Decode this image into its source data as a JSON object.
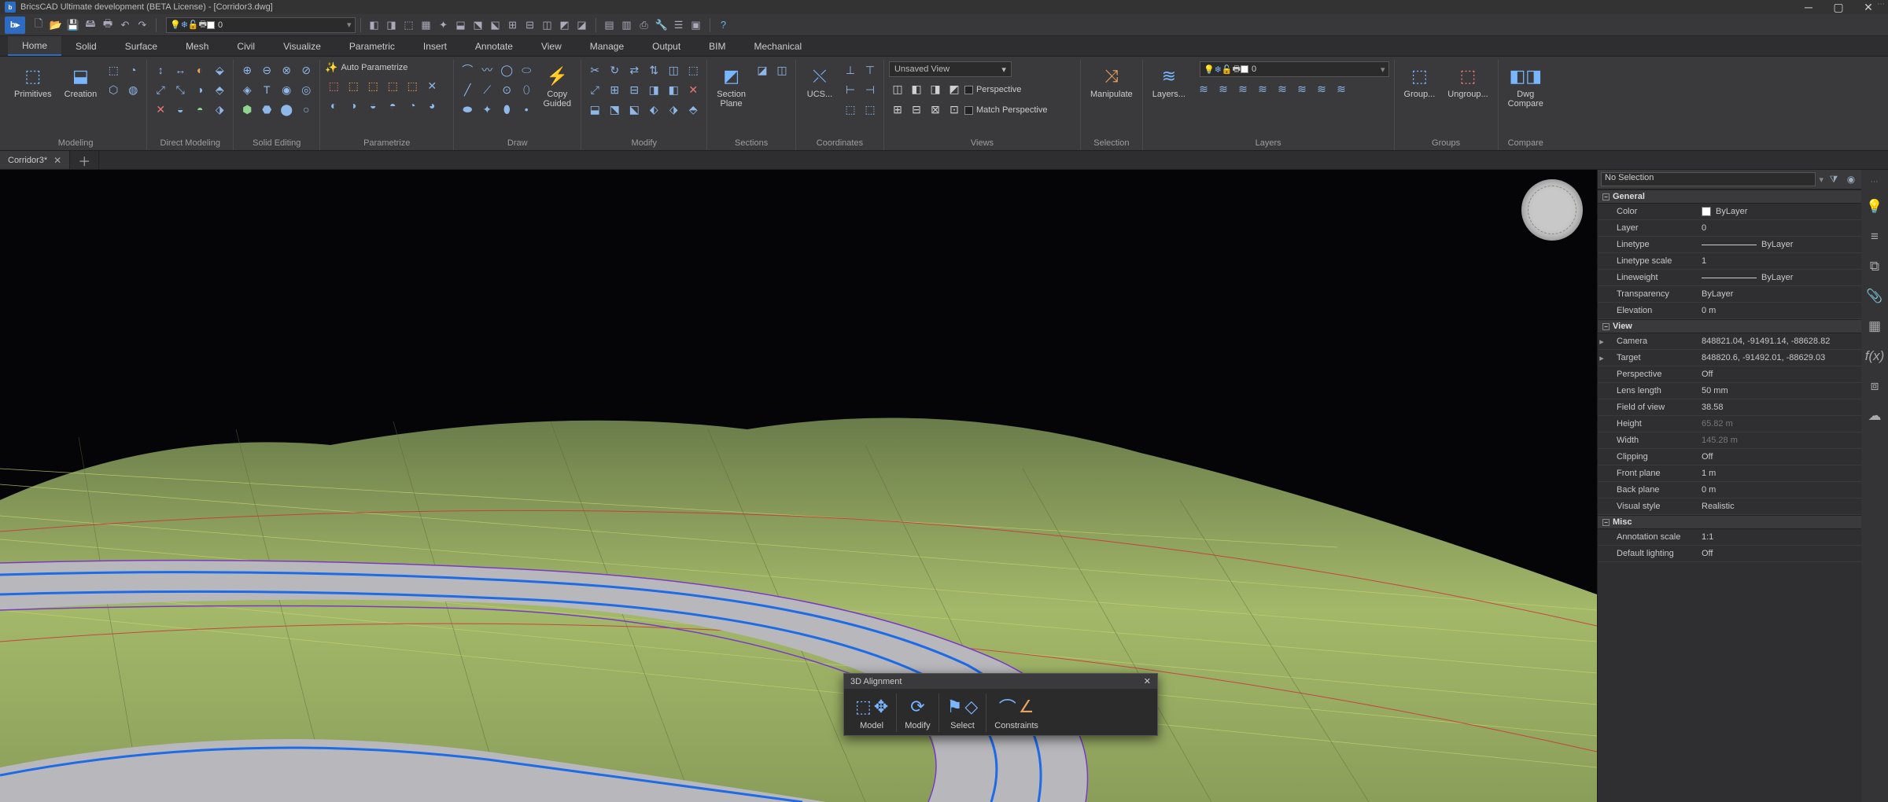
{
  "title": "BricsCAD Ultimate development (BETA License) - [Corridor3.dwg]",
  "qat_layer": "0",
  "ribbon_tabs": [
    "Home",
    "Solid",
    "Surface",
    "Mesh",
    "Civil",
    "Visualize",
    "Parametric",
    "Insert",
    "Annotate",
    "View",
    "Manage",
    "Output",
    "BIM",
    "Mechanical"
  ],
  "active_tab": 0,
  "panels": {
    "modeling": {
      "label": "Modeling",
      "primitives": "Primitives",
      "creation": "Creation"
    },
    "direct_modeling": {
      "label": "Direct Modeling"
    },
    "solid_editing": {
      "label": "Solid Editing"
    },
    "parametrize": {
      "label": "Parametrize",
      "auto": "Auto Parametrize"
    },
    "draw": {
      "label": "Draw",
      "copy_guided": "Copy\nGuided"
    },
    "modify": {
      "label": "Modify"
    },
    "sections": {
      "label": "Sections",
      "section_plane": "Section\nPlane"
    },
    "coordinates": {
      "label": "Coordinates",
      "ucs": "UCS..."
    },
    "views": {
      "label": "Views",
      "unsaved": "Unsaved View",
      "perspective": "Perspective",
      "match": "Match Perspective"
    },
    "selection": {
      "label": "Selection",
      "manipulate": "Manipulate"
    },
    "layers": {
      "label": "Layers",
      "layers_btn": "Layers...",
      "layer_combo": "0"
    },
    "groups": {
      "label": "Groups",
      "group": "Group...",
      "ungroup": "Ungroup..."
    },
    "compare": {
      "label": "Compare",
      "dwg": "Dwg\nCompare"
    }
  },
  "file_tabs": [
    {
      "name": "Corridor3*"
    }
  ],
  "alignment": {
    "title": "3D Alignment",
    "cells": [
      "Model",
      "Modify",
      "Select",
      "Constraints"
    ]
  },
  "properties": {
    "selection": "No Selection",
    "sections": {
      "general": {
        "title": "General",
        "rows": [
          {
            "k": "Color",
            "v": "ByLayer",
            "swatch": true
          },
          {
            "k": "Layer",
            "v": "0"
          },
          {
            "k": "Linetype",
            "v": "ByLayer",
            "line": true
          },
          {
            "k": "Linetype scale",
            "v": "1"
          },
          {
            "k": "Lineweight",
            "v": "ByLayer",
            "line": true
          },
          {
            "k": "Transparency",
            "v": "ByLayer"
          },
          {
            "k": "Elevation",
            "v": "0 m"
          }
        ]
      },
      "view": {
        "title": "View",
        "rows": [
          {
            "k": "Camera",
            "v": "848821.04, -91491.14, -88628.82",
            "exp": true
          },
          {
            "k": "Target",
            "v": "848820.6, -91492.01, -88629.03",
            "exp": true
          },
          {
            "k": "Perspective",
            "v": "Off"
          },
          {
            "k": "Lens length",
            "v": "50 mm"
          },
          {
            "k": "Field of view",
            "v": "38.58"
          },
          {
            "k": "Height",
            "v": "65.82 m",
            "dim": true
          },
          {
            "k": "Width",
            "v": "145.28 m",
            "dim": true
          },
          {
            "k": "Clipping",
            "v": "Off"
          },
          {
            "k": "Front plane",
            "v": "1 m"
          },
          {
            "k": "Back plane",
            "v": "0 m"
          },
          {
            "k": "Visual style",
            "v": "Realistic"
          }
        ]
      },
      "misc": {
        "title": "Misc",
        "rows": [
          {
            "k": "Annotation scale",
            "v": "1:1"
          },
          {
            "k": "Default lighting",
            "v": "Off"
          }
        ]
      }
    }
  }
}
